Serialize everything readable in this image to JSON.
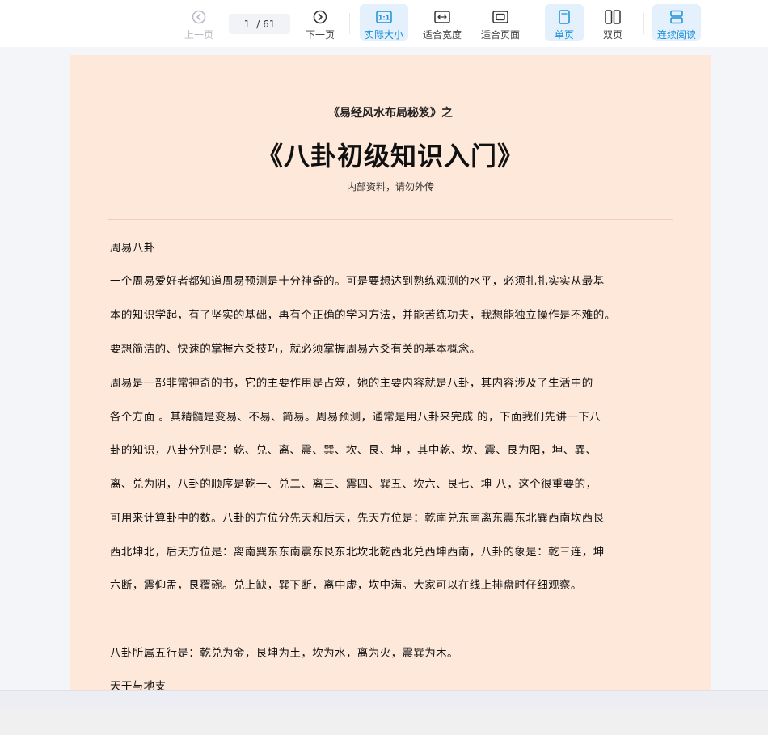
{
  "toolbar": {
    "prev_label": "上一页",
    "current_page": "1",
    "total_pages": "/ 61",
    "next_label": "下一页",
    "actual_size_label": "实际大小",
    "fit_width_label": "适合宽度",
    "fit_page_label": "适合页面",
    "single_page_label": "单页",
    "double_page_label": "双页",
    "continuous_label": "连续阅读"
  },
  "document": {
    "subtitle": "《易经风水布局秘笈》之",
    "title": "《八卦初级知识入门》",
    "note": "内部资料，请勿外传",
    "lines": [
      "周易八卦",
      "一个周易爱好者都知道周易预测是十分神奇的。可是要想达到熟练观测的水平，必须扎扎实实从最基",
      "本的知识学起，有了坚实的基础，再有个正确的学习方法，并能苦练功夫，我想能独立操作是不难的。",
      "要想简洁的、快速的掌握六爻技巧，就必须掌握周易六爻有关的基本概念。",
      " 周易是一部非常神奇的书，它的主要作用是占筮，她的主要内容就是八卦，其内容涉及了生活中的",
      "各个方面 。其精髓是变易、不易、简易。周易预测，通常是用八卦来完成 的，下面我们先讲一下八",
      "卦的知识，八卦分别是：乾、兑、离、震、巽、坎、艮、坤 ，其中乾、坎、震、艮为阳，坤、巽、",
      "离、兑为阴，八卦的顺序是乾一、兑二、离三、震四、巽五、坎六、艮七、坤 八，这个很重要的，",
      "可用来计算卦中的数。八卦的方位分先天和后天，先天方位是：乾南兑东南离东震东北巽西南坎西艮",
      "西北坤北，后天方位是：离南巽东东南震东艮东北坎北乾西北兑西坤西南，八卦的象是：乾三连，坤",
      "六断，震仰盂，艮覆碗。兑上缺，巽下断，离中虚，坎中满。大家可以在线上排盘时仔细观察。",
      "八卦所属五行是：乾兑为金，艮坤为土，坎为水，离为火，震巽为木。",
      "天干与地支"
    ]
  }
}
